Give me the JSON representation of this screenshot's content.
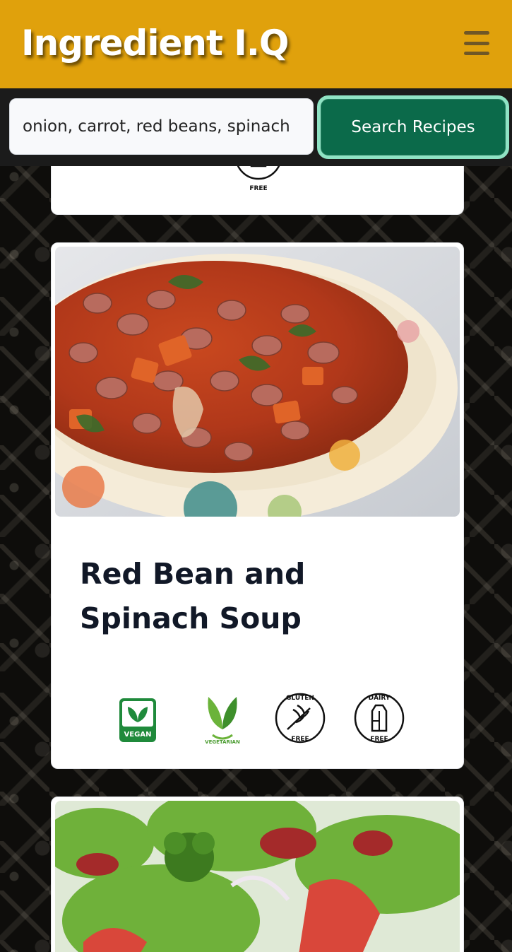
{
  "app": {
    "title": "Ingredient I.Q",
    "menu_icon": "hamburger-menu-icon"
  },
  "search": {
    "value": "onion, carrot, red beans, spinach",
    "placeholder": "",
    "button_label": "Search Recipes"
  },
  "recipes": [
    {
      "title": "",
      "badges": [
        "dairy-free-badge"
      ]
    },
    {
      "title": "Red Bean and Spinach Soup",
      "badges": [
        "vegan-badge",
        "vegetarian-badge",
        "gluten-free-badge",
        "dairy-free-badge"
      ],
      "badge_texts": {
        "vegan": "VEGAN",
        "vegetarian": "VEGETARIAN",
        "gluten_top": "GLUTEN",
        "free": "FREE",
        "dairy_top": "DAIRY"
      }
    },
    {
      "title": "",
      "badges": []
    }
  ],
  "colors": {
    "header": "#e0a10c",
    "search_button": "#0b6a4a",
    "search_button_ring": "#8fe3c4",
    "vegan_green": "#1f8a3b",
    "title_text": "#111827"
  }
}
